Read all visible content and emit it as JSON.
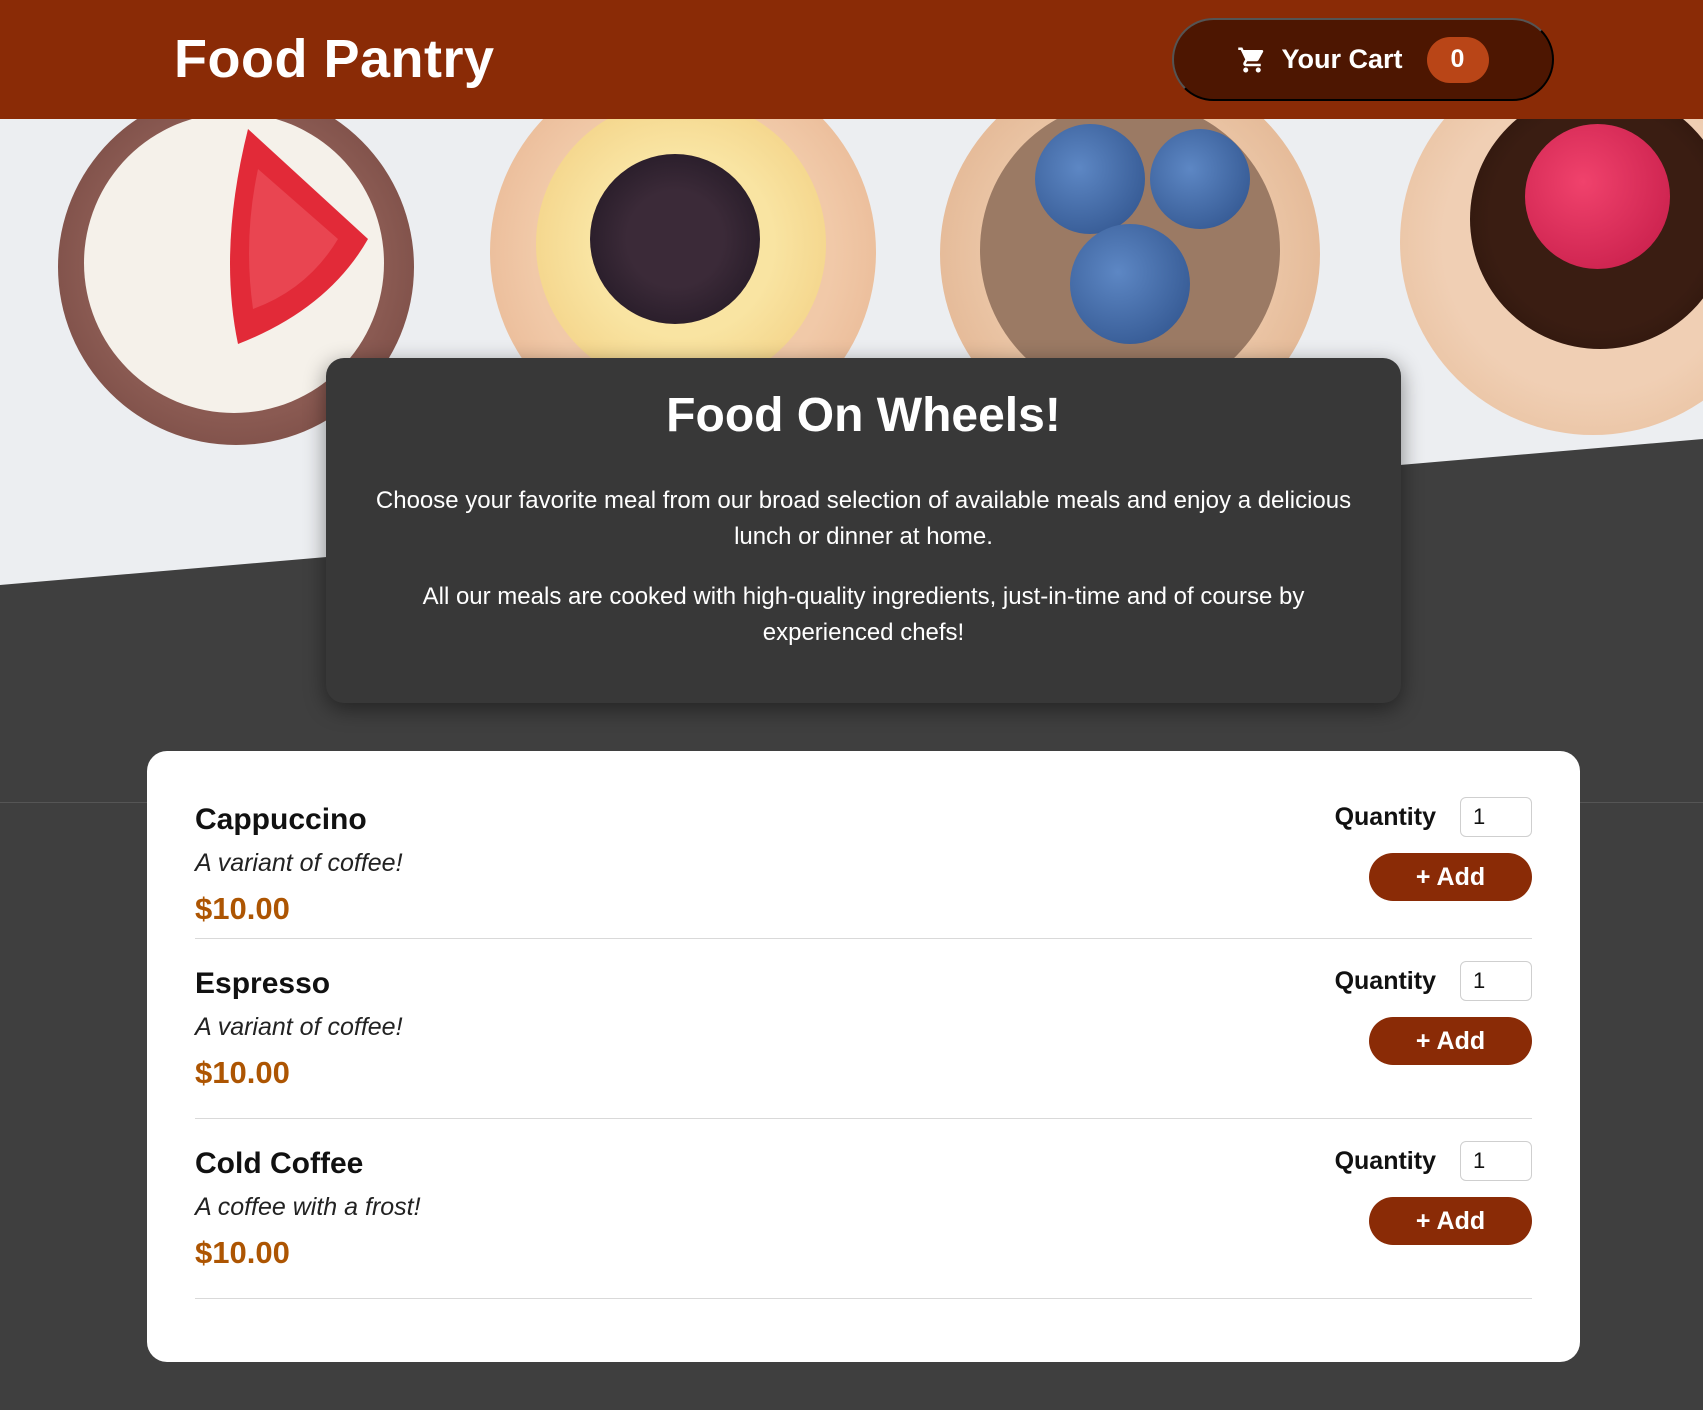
{
  "header": {
    "brand": "Food Pantry",
    "cart": {
      "label": "Your Cart",
      "count": "0",
      "icon": "cart-icon"
    }
  },
  "summary": {
    "title": "Food On Wheels!",
    "paragraphs": [
      "Choose your favorite meal from our broad selection of available meals and enjoy a delicious lunch or dinner at home.",
      "All our meals are cooked with high-quality ingredients, just-in-time and of course by experienced chefs!"
    ]
  },
  "meals": [
    {
      "name": "Cappuccino",
      "description": "A variant of coffee!",
      "price": "$10.00",
      "quantity_label": "Quantity",
      "quantity": "1",
      "add_label": "+ Add"
    },
    {
      "name": "Espresso",
      "description": "A variant of coffee!",
      "price": "$10.00",
      "quantity_label": "Quantity",
      "quantity": "1",
      "add_label": "+ Add"
    },
    {
      "name": "Cold Coffee",
      "description": "A coffee with a frost!",
      "price": "$10.00",
      "quantity_label": "Quantity",
      "quantity": "1",
      "add_label": "+ Add"
    }
  ],
  "colors": {
    "header": "#8a2b06",
    "cart_button": "#4d1601",
    "cart_badge": "#b94517",
    "background": "#3f3f3f",
    "summary_card": "#383838",
    "price": "#ad5502",
    "add_button": "#8a2b06"
  }
}
